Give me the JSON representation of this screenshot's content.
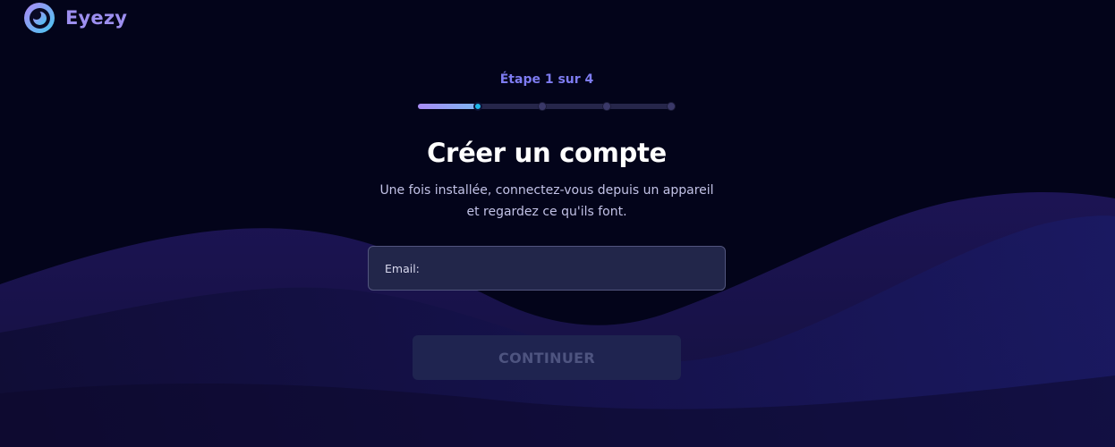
{
  "brand": {
    "name": "Eyezy",
    "logo_icon": "eyezy-logo-icon"
  },
  "steps": {
    "label": "Étape 1 sur 4",
    "current": 1,
    "total": 4,
    "completed_fraction": 0.23
  },
  "form": {
    "title": "Créer un compte",
    "subtitle_line1": "Une fois installée, connectez-vous depuis un appareil",
    "subtitle_line2": "et regardez ce qu'ils font.",
    "email_label": "Email:",
    "email_value": "",
    "continue_label": "CONTINUER"
  },
  "colors": {
    "background": "#03041a",
    "brand": "#9d8ff0",
    "step_label": "#7e7cf2",
    "progress_start": "#a98cf5",
    "progress_end": "#7fb4f2",
    "active_dot": "#1fb8e8",
    "input_bg": "#22264a",
    "button_disabled_bg": "#1f2450",
    "button_disabled_text": "#4e5480"
  }
}
